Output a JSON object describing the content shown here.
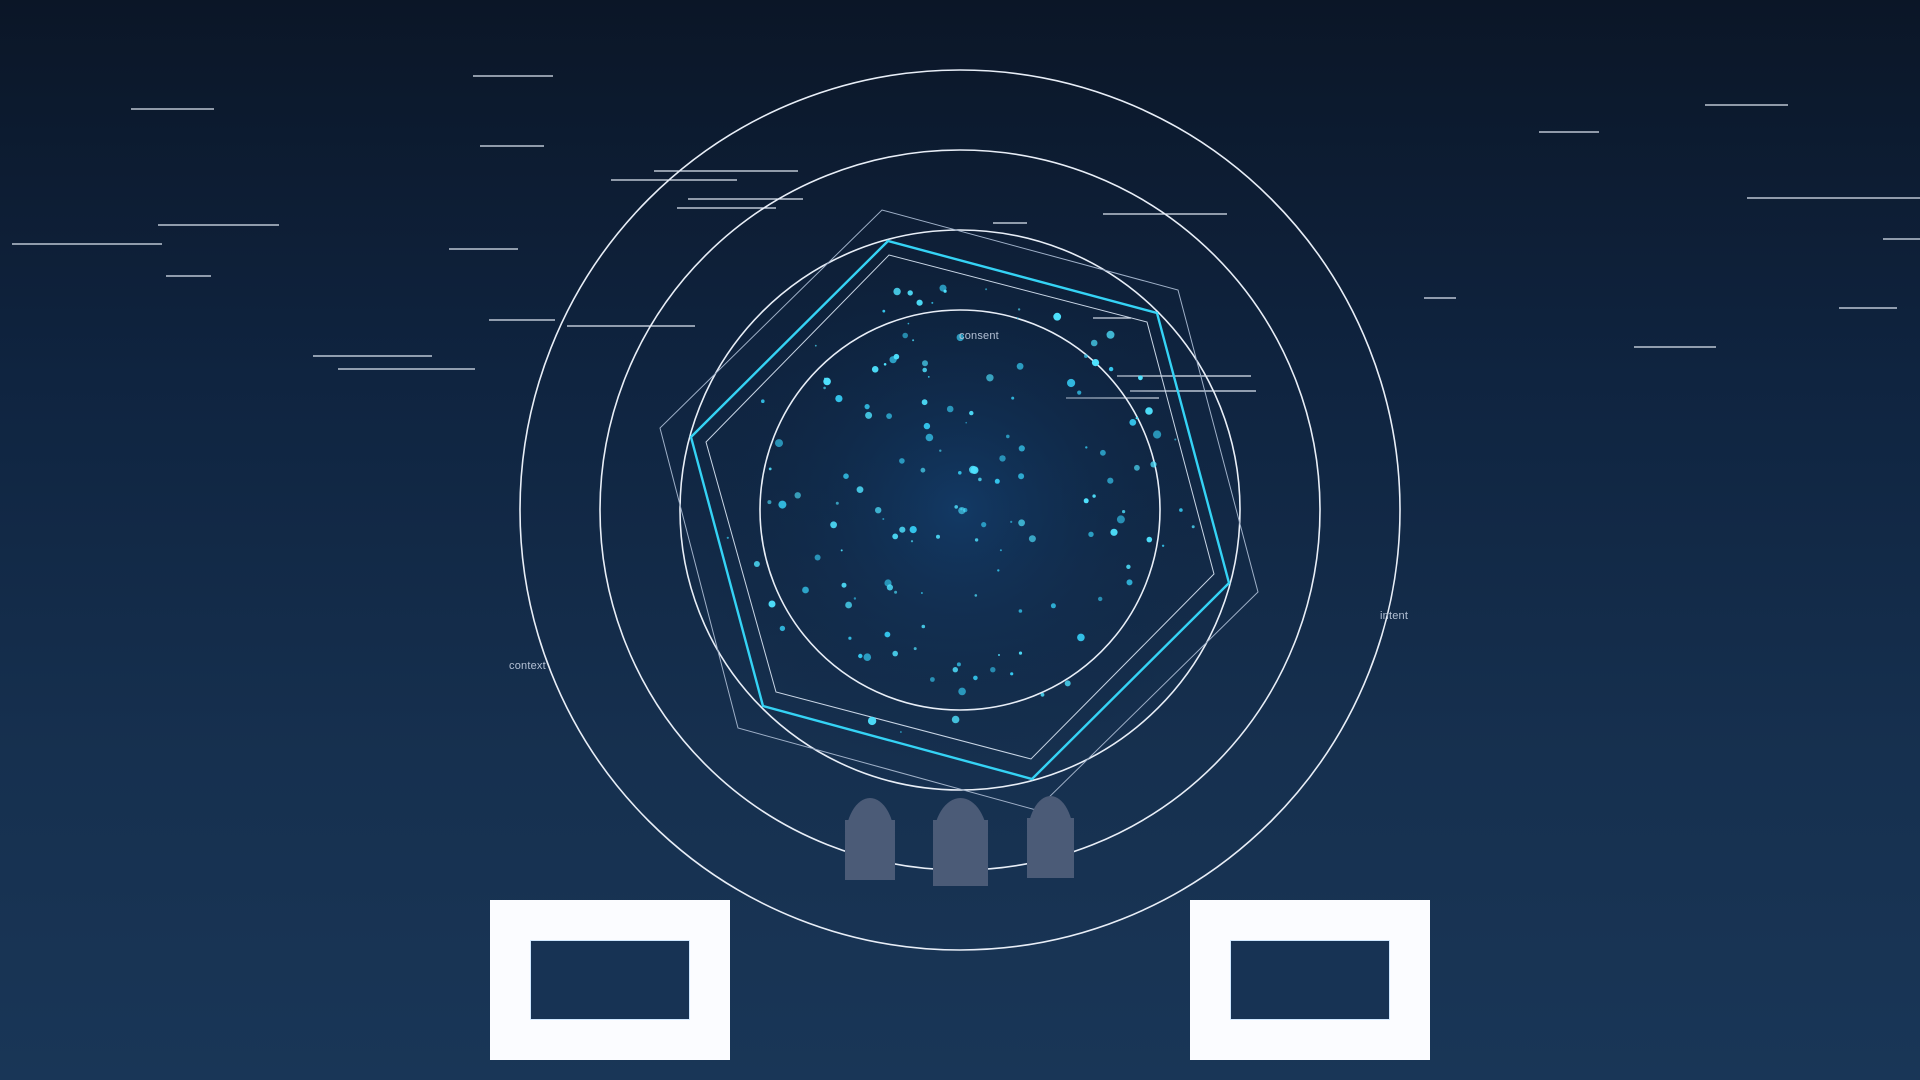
{
  "labels": {
    "top": "consent",
    "left": "context",
    "right": "intent"
  },
  "colors": {
    "background_top": "#0b1627",
    "background_bottom": "#193657",
    "ring": "#e8eef7",
    "accent": "#35d3f5",
    "particle": "#4fe3ff",
    "pedestal": "#4b5b77",
    "frame": "#fbfcff"
  },
  "elements": {
    "rings": 4,
    "polygons": [
      "outer-hexagon-outline",
      "accent-hexagon",
      "inner-hexagon-outline"
    ],
    "pedestals": 3,
    "frames": 2
  }
}
